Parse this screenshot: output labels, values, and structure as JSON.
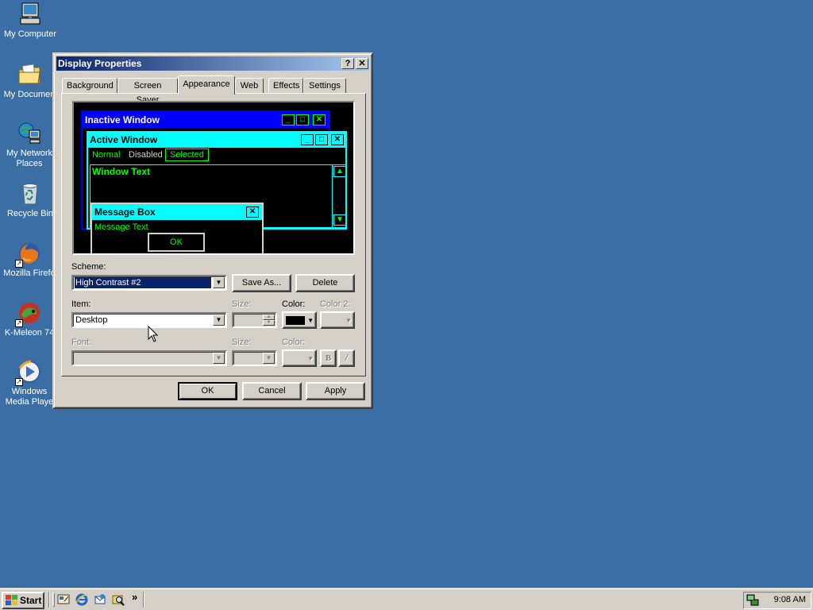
{
  "desktop": {
    "icons": [
      {
        "label": "My Computer",
        "icon": "my-computer-icon"
      },
      {
        "label": "My Documen",
        "icon": "my-documents-icon"
      },
      {
        "label": "My Network Places",
        "icon": "network-places-icon"
      },
      {
        "label": "Recycle Bin",
        "icon": "recycle-bin-icon"
      },
      {
        "label": "Mozilla Firefo",
        "icon": "firefox-icon"
      },
      {
        "label": "K-Meleon 74",
        "icon": "k-meleon-icon"
      },
      {
        "label": "Windows Media Playe",
        "icon": "media-player-icon"
      }
    ]
  },
  "dialog": {
    "title": "Display Properties",
    "help_glyph": "?",
    "close_glyph": "✕",
    "tabs": [
      {
        "label": "Background"
      },
      {
        "label": "Screen Saver"
      },
      {
        "label": "Appearance"
      },
      {
        "label": "Web"
      },
      {
        "label": "Effects"
      },
      {
        "label": "Settings"
      }
    ],
    "active_tab": "Appearance",
    "preview": {
      "inactive_title": "Inactive Window",
      "active_title": "Active Window",
      "menu_normal": "Normal",
      "menu_disabled": "Disabled",
      "menu_selected": "Selected",
      "window_text": "Window Text",
      "msgbox_title": "Message Box",
      "msgbox_text": "Message Text",
      "msgbox_ok": "OK"
    },
    "scheme_label": "Scheme:",
    "scheme_value": "High Contrast #2",
    "save_as": "Save As...",
    "delete": "Delete",
    "item_label": "Item:",
    "item_value": "Desktop",
    "size_label": "Size:",
    "color_label": "Color:",
    "color2_label": "Color 2:",
    "font_label": "Font:",
    "font_size_label": "Size:",
    "font_color_label": "Color:",
    "bold_glyph": "B",
    "italic_glyph": "/",
    "ok": "OK",
    "cancel": "Cancel",
    "apply": "Apply"
  },
  "taskbar": {
    "start": "Start",
    "more_glyph": "»",
    "clock": "9:08 AM"
  },
  "colors": {
    "desktop": "#3a6ea5",
    "face": "#d4d0c8",
    "title_active": "#0a246a",
    "hc_green": "#00ff00",
    "hc_cyan": "#00ffff",
    "hc_blue": "#0000ff"
  }
}
